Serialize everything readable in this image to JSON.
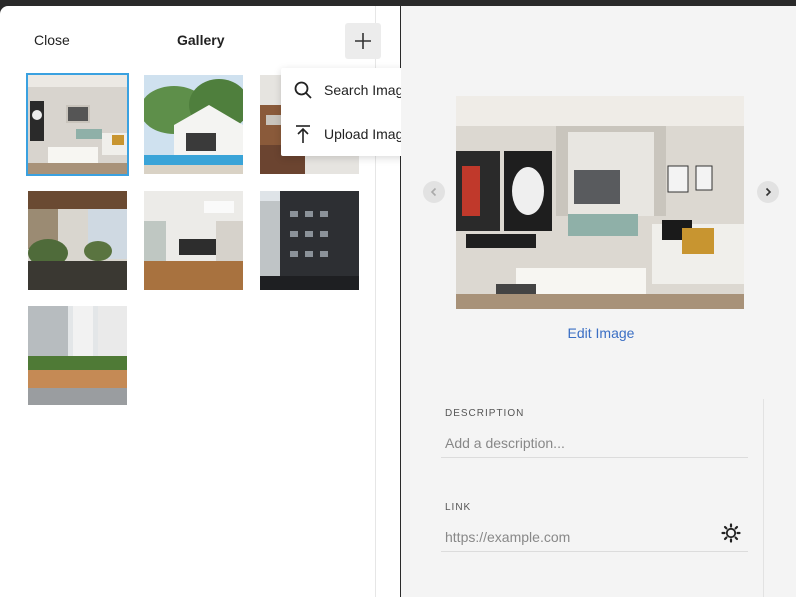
{
  "header": {
    "close_label": "Close",
    "title": "Gallery"
  },
  "add_menu": {
    "items": [
      {
        "label": "Search Images",
        "icon": "search-icon"
      },
      {
        "label": "Upload Images",
        "icon": "upload-icon"
      }
    ]
  },
  "gallery": {
    "selected_index": 0,
    "count": 7
  },
  "detail": {
    "edit_label": "Edit Image",
    "description": {
      "label": "DESCRIPTION",
      "value": "",
      "placeholder": "Add a description..."
    },
    "link": {
      "label": "LINK",
      "value": "",
      "placeholder": "https://example.com"
    }
  },
  "colors": {
    "accent": "#3aa1e0",
    "link": "#3b6fc4",
    "panel_bg": "#f4f4f4"
  }
}
